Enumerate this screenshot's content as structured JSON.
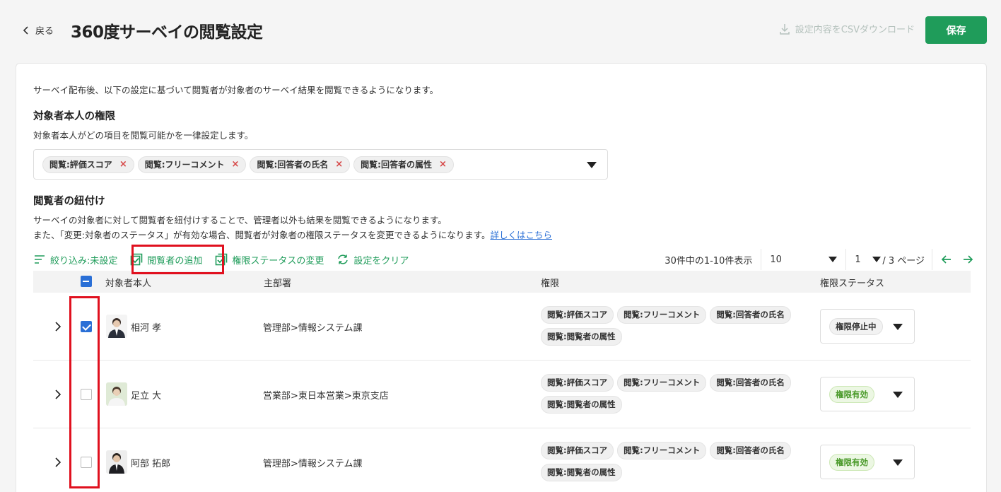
{
  "header": {
    "back_label": "戻る",
    "title": "360度サーベイの閲覧設定",
    "csv_label": "設定内容をCSVダウンロード",
    "save_label": "保存"
  },
  "card": {
    "intro": "サーベイ配布後、以下の設定に基づいて閲覧者が対象者のサーベイ結果を閲覧できるようになります。",
    "self_section": {
      "title": "対象者本人の権限",
      "desc": "対象者本人がどの項目を閲覧可能かを一律設定します。",
      "tags": [
        "閲覧:評価スコア",
        "閲覧:フリーコメント",
        "閲覧:回答者の氏名",
        "閲覧:回答者の属性"
      ],
      "remove_glyph": "×"
    },
    "viewer_section": {
      "title": "閲覧者の紐付け",
      "desc_line1": "サーベイの対象者に対して閲覧者を紐付けすることで、管理者以外も結果を閲覧できるようになります。",
      "desc_line2": "また、「変更:対象者のステータス」が有効な場合、閲覧者が対象者の権限ステータスを変更できるようになります。",
      "link": "詳しくはこちら"
    }
  },
  "toolbar": {
    "filter": "絞り込み:未設定",
    "add_viewer": "閲覧者の追加",
    "change_status": "権限ステータスの変更",
    "clear": "設定をクリア",
    "count_text": "30件中の1-10件表示",
    "per_page": "10",
    "page": "1",
    "page_total": "/ 3 ページ"
  },
  "table": {
    "headers": [
      "対象者本人",
      "主部署",
      "権限",
      "権限ステータス"
    ],
    "header_checkbox_state": "indeterminate",
    "rows": [
      {
        "name": "相河 孝",
        "dept": "管理部>情報システム課",
        "perms": [
          "閲覧:評価スコア",
          "閲覧:フリーコメント",
          "閲覧:回答者の氏名",
          "閲覧:閲覧者の属性"
        ],
        "status": "権限停止中",
        "checked": true
      },
      {
        "name": "足立 大",
        "dept": "営業部>東日本営業>東京支店",
        "perms": [
          "閲覧:評価スコア",
          "閲覧:フリーコメント",
          "閲覧:回答者の氏名",
          "閲覧:閲覧者の属性"
        ],
        "status": "権限有効",
        "checked": false
      },
      {
        "name": "阿部 拓郎",
        "dept": "管理部>情報システム課",
        "perms": [
          "閲覧:評価スコア",
          "閲覧:フリーコメント",
          "閲覧:回答者の氏名",
          "閲覧:閲覧者の属性"
        ],
        "status": "権限有効",
        "checked": false
      }
    ]
  },
  "colors": {
    "accent_green": "#1f9c5a",
    "highlight_red": "#e0101e",
    "checkbox_blue": "#2a6fd6",
    "link_blue": "#2a6fd6"
  },
  "icons": [
    "chevron-left-icon",
    "download-icon",
    "filter-icon",
    "add-viewer-icon",
    "status-change-icon",
    "refresh-icon",
    "arrow-left-icon",
    "arrow-right-icon",
    "chevron-right-icon",
    "caret-down-icon"
  ]
}
